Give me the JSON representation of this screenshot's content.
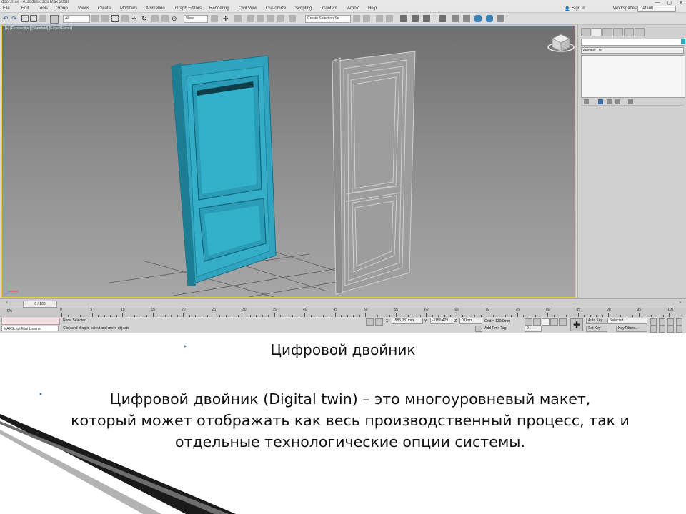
{
  "app": {
    "title": "door.max - Autodesk 3ds Max 2018",
    "window_controls": [
      "—",
      "▢",
      "✕"
    ],
    "menu": [
      "File",
      "Edit",
      "Tools",
      "Group",
      "Views",
      "Create",
      "Modifiers",
      "Animation",
      "Graph Editors",
      "Rendering",
      "Civil View",
      "Customize",
      "Scripting",
      "Content",
      "Arnold",
      "Help"
    ],
    "sign_in": "Sign In",
    "workspaces_label": "Workspaces:",
    "workspace_value": "Default",
    "toolbar": {
      "filter_combo": "All",
      "coord_combo": "View",
      "selection_set_combo": "Create Selection Se"
    },
    "viewport": {
      "label": "[+] [Perspective] [Standard] [Edged Faces]"
    },
    "right_panel": {
      "modifier_list": "Modifier List"
    },
    "timeline": {
      "slider_label": "0 / 100",
      "ruler_labels": [
        "0",
        "5",
        "10",
        "15",
        "20",
        "25",
        "30",
        "35",
        "40",
        "45",
        "50",
        "55",
        "60",
        "65",
        "70",
        "75",
        "80",
        "85",
        "90",
        "95",
        "100"
      ]
    },
    "status": {
      "maxscript_label": "MAXScript Mini Listener",
      "selected": "None Selected",
      "prompt": "Click and drag to select and move objects",
      "x_label": "X:",
      "x_value": "-585,081mm",
      "y_label": "Y:",
      "y_value": "-1150,429",
      "z_label": "Z:",
      "z_value": "0,0mm",
      "grid": "Grid = 120,0mm",
      "add_time_tag": "Add Time Tag",
      "auto_key": "Auto Key",
      "selected_combo": "Selected",
      "set_key": "Set Key",
      "key_filters": "Key Filters...",
      "frame_value": "0"
    }
  },
  "slide": {
    "heading": "Цифровой двойник",
    "paragraph_lead": "Цифровой двойник (Digital twin) – это многоуровневый макет,",
    "paragraph_rest": "который может отображать как весь производственный процесс, так и отдельные технологические опции системы.",
    "bullet_glyph": "‣",
    "accent_color": "#4d7fa9"
  }
}
